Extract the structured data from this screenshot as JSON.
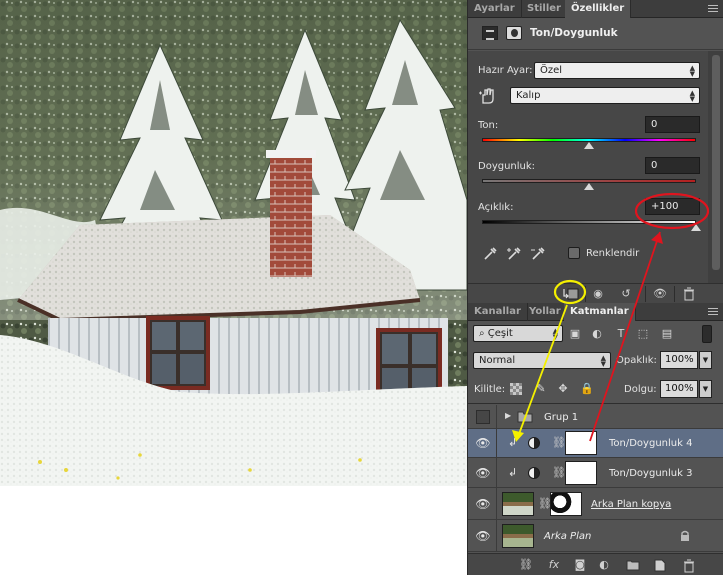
{
  "properties_tabs": [
    "Ayarlar",
    "Stiller",
    "Özellikler"
  ],
  "properties": {
    "title": "Ton/Doygunluk",
    "preset_label": "Hazır Ayar:",
    "preset_value": "Özel",
    "channel_value": "Kalıp",
    "hue_label": "Ton:",
    "hue_value": "0",
    "saturation_label": "Doygunluk:",
    "saturation_value": "0",
    "lightness_label": "Açıklık:",
    "lightness_value": "+100",
    "colorize_label": "Renklendir",
    "colorize_checked": false,
    "hue_level": 0.5,
    "saturation_level": 0.5,
    "lightness_level": 1.0
  },
  "layers_tabs": [
    "Kanallar",
    "Yollar",
    "Katmanlar"
  ],
  "layers_panel": {
    "filter_kind": "Çeşit",
    "blend_mode": "Normal",
    "opacity_label": "Opaklık:",
    "opacity_value": "100%",
    "lock_label": "Kilitle:",
    "fill_label": "Dolgu:",
    "fill_value": "100%"
  },
  "layers": [
    {
      "name": "Grup 1",
      "type": "group",
      "visible": false,
      "selected": false
    },
    {
      "name": "Ton/Doygunluk 4",
      "type": "adjustment",
      "visible": true,
      "selected": true,
      "clipped": true
    },
    {
      "name": "Ton/Doygunluk 3",
      "type": "adjustment",
      "visible": true,
      "selected": false,
      "clipped": true
    },
    {
      "name": "Arka Plan kopya",
      "type": "smart",
      "visible": true,
      "selected": false
    },
    {
      "name": "Arka Plan",
      "type": "background",
      "visible": true,
      "selected": false,
      "locked": true
    }
  ],
  "icons": {
    "eye": "eye-icon",
    "lock": "lock-icon",
    "chain": "chain-link-icon",
    "clip": "clip-arrow-icon",
    "folder": "folder-icon",
    "trash": "trash-icon"
  },
  "colors": {
    "panel": "#535353",
    "selected_layer": "#5f6e86",
    "annotation_red": "#e0141e",
    "annotation_yellow": "#f4f000"
  }
}
